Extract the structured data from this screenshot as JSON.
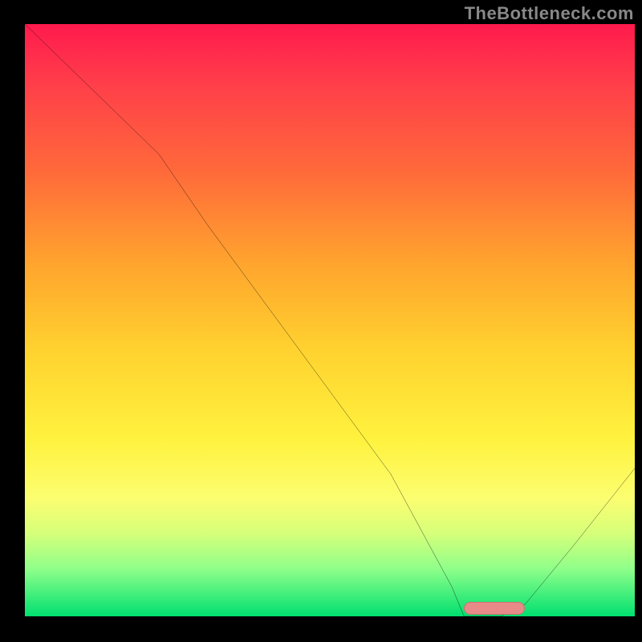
{
  "watermark": "TheBottleneck.com",
  "colors": {
    "gradient_top": "#ff1a4d",
    "gradient_bottom": "#00e070",
    "curve": "#000000",
    "marker": "#e78a88",
    "axes": "#000000"
  },
  "chart_data": {
    "type": "line",
    "title": "",
    "xlabel": "",
    "ylabel": "",
    "xlim": [
      0,
      100
    ],
    "ylim": [
      0,
      100
    ],
    "grid": false,
    "x": [
      0,
      18,
      22,
      30,
      40,
      50,
      60,
      70,
      72,
      78,
      82,
      90,
      100
    ],
    "values": [
      100,
      82,
      78,
      66,
      52,
      38,
      24,
      5,
      0,
      0,
      2,
      12,
      25
    ],
    "marker": {
      "x_start": 72,
      "x_end": 82,
      "y": 0
    },
    "legend": [],
    "annotations": []
  }
}
